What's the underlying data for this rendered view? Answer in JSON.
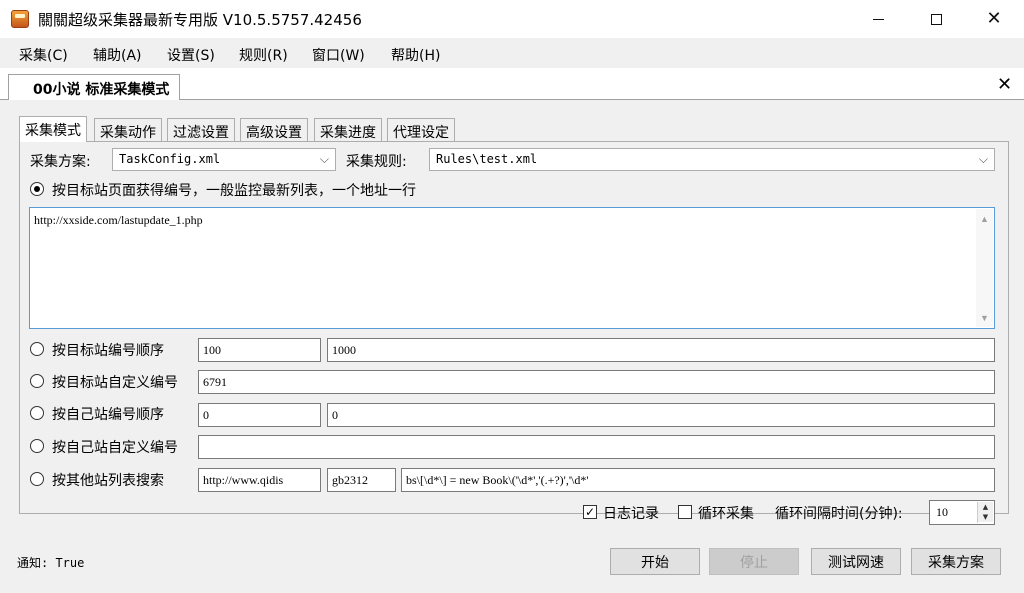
{
  "window": {
    "title": "關關超级采集器最新专用版 V10.5.5757.42456"
  },
  "menu": [
    "采集(C)",
    "辅助(A)",
    "设置(S)",
    "规则(R)",
    "窗口(W)",
    "帮助(H)"
  ],
  "document_tab": "00小说 标准采集模式",
  "tabs": [
    "采集模式",
    "采集动作",
    "过滤设置",
    "高级设置",
    "采集进度",
    "代理设定"
  ],
  "scheme": {
    "label": "采集方案:",
    "value": "TaskConfig.xml"
  },
  "rules": {
    "label": "采集规则:",
    "value": "Rules\\test.xml"
  },
  "options": {
    "monitor_label": "按目标站页面获得编号，一般监控最新列表，一个地址一行",
    "url_list": "http://xxside.com/lastupdate_1.php",
    "target_seq_label": "按目标站编号顺序",
    "target_seq_from": "100",
    "target_seq_to": "1000",
    "target_custom_label": "按目标站自定义编号",
    "target_custom_value": "6791",
    "own_seq_label": "按自己站编号顺序",
    "own_seq_from": "0",
    "own_seq_to": "0",
    "own_custom_label": "按自己站自定义编号",
    "own_custom_value": "",
    "search_label": "按其他站列表搜索",
    "search_url": "http://www.qidis",
    "search_encoding": "gb2312",
    "search_regex": "bs\\[\\d*\\] = new Book\\('\\d*','(.+?)','\\d*'"
  },
  "bottom_options": {
    "log_label": "日志记录",
    "log_checked": true,
    "loop_label": "循环采集",
    "loop_checked": false,
    "interval_label": "循环间隔时间(分钟):",
    "interval_value": "10"
  },
  "status_text": "通知: True",
  "buttons": {
    "start": "开始",
    "stop": "停止",
    "speed": "测试网速",
    "scheme": "采集方案"
  }
}
